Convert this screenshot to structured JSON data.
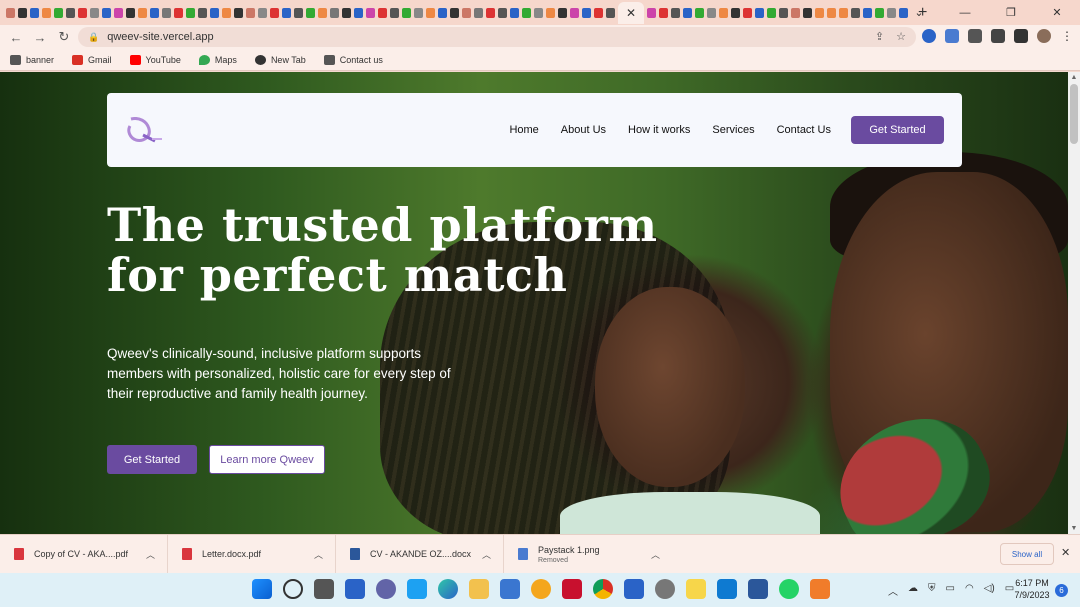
{
  "browser": {
    "active_tab_close": "✕",
    "new_tab": "+",
    "window_controls": [
      "⌄",
      "—",
      "❐",
      "✕"
    ],
    "url": "qweev-site.vercel.app",
    "nav": {
      "back": "←",
      "forward": "→",
      "reload": "↻"
    }
  },
  "bookmarks": [
    {
      "label": "banner",
      "color": "#555555"
    },
    {
      "label": "Gmail",
      "color": "#d93025"
    },
    {
      "label": "YouTube",
      "color": "#ff0000"
    },
    {
      "label": "Maps",
      "color": "#34a853"
    },
    {
      "label": "New Tab",
      "color": "#333333"
    },
    {
      "label": "Contact us",
      "color": "#555555"
    }
  ],
  "site": {
    "brand_color": "#6a4ba0",
    "nav_links": [
      "Home",
      "About Us",
      "How it works",
      "Services",
      "Contact Us"
    ],
    "nav_cta": "Get Started",
    "hero_title_line1": "The trusted platform",
    "hero_title_line2": "for perfect match",
    "hero_subtitle": "Qweev's clinically-sound, inclusive platform supports members with personalized, holistic care for every step of their reproductive and family health journey.",
    "primary_button": "Get Started",
    "secondary_button": "Learn more Qweev"
  },
  "downloads": [
    {
      "name": "Copy of CV - AKA....pdf",
      "status": "",
      "icon": "pdf-icon",
      "color": "#d9363e"
    },
    {
      "name": "Letter.docx.pdf",
      "status": "",
      "icon": "pdf-icon",
      "color": "#d9363e"
    },
    {
      "name": "CV - AKANDE OZ....docx",
      "status": "",
      "icon": "word-icon",
      "color": "#2b579a"
    },
    {
      "name": "Paystack 1.png",
      "status": "Removed",
      "icon": "image-icon",
      "color": "#4a7bd0"
    }
  ],
  "downloads_show_all": "Show all",
  "taskbar": {
    "time": "6:17 PM",
    "date": "7/9/2023",
    "notification_count": "6"
  }
}
